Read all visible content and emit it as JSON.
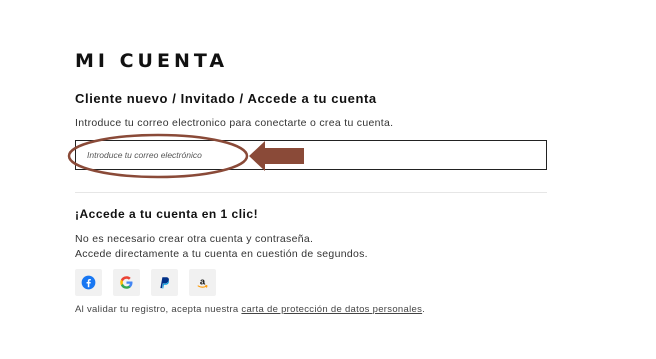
{
  "page": {
    "title": "MI CUENTA",
    "subtitle": "Cliente nuevo / Invitado / Accede a tu cuenta",
    "intro": "Introduce tu correo electronico para conectarte o crea tu cuenta."
  },
  "email": {
    "placeholder": "Introduce tu correo electrónico",
    "value": ""
  },
  "annotation": {
    "color": "#8a4a38",
    "shapes": [
      "ellipse",
      "arrow"
    ]
  },
  "one_click": {
    "title": "¡Accede a tu cuenta en 1 clic!",
    "line1": "No es necesario crear otra cuenta y contraseña.",
    "line2": "Accede directamente a tu cuenta en cuestión de segundos.",
    "providers": [
      {
        "name": "facebook",
        "icon": "facebook-icon",
        "color": "#1877f2"
      },
      {
        "name": "google",
        "icon": "google-icon",
        "color": "#4285f4"
      },
      {
        "name": "paypal",
        "icon": "paypal-icon",
        "color": "#003087"
      },
      {
        "name": "amazon",
        "icon": "amazon-icon",
        "color": "#ff9900"
      }
    ]
  },
  "legal": {
    "prefix": "Al validar tu registro, acepta nuestra ",
    "link": "carta de protección de datos personales",
    "suffix": "."
  }
}
